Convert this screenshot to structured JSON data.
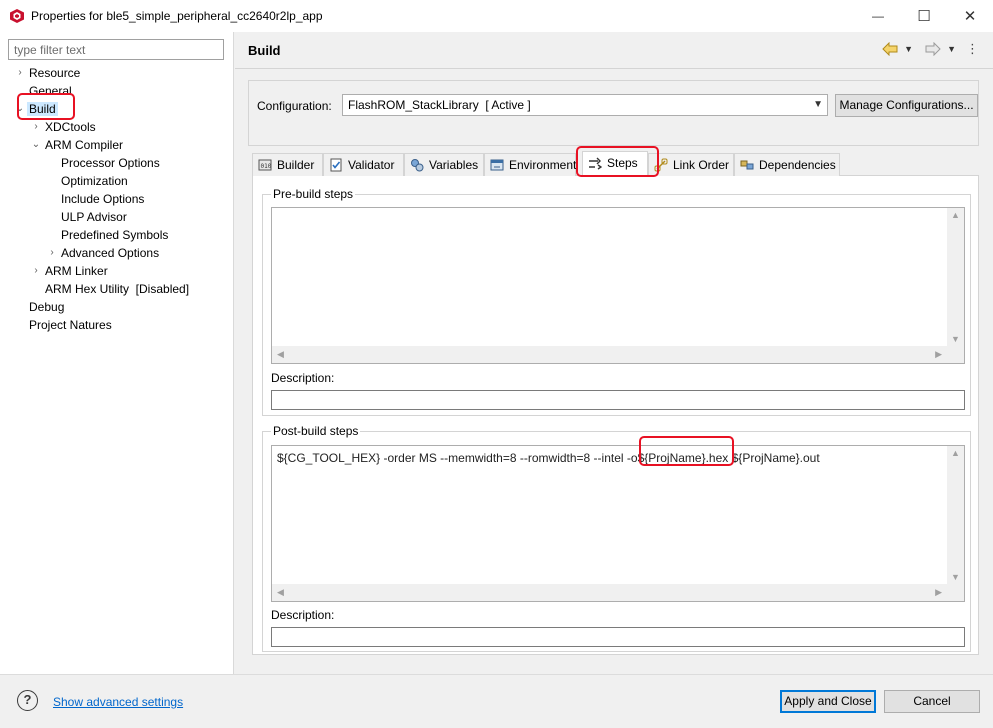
{
  "window": {
    "title": "Properties for ble5_simple_peripheral_cc2640r2lp_app",
    "minimize_glyph": "—",
    "maximize_glyph": "☐",
    "close_glyph": "✕"
  },
  "filter": {
    "placeholder": "type filter text",
    "value": ""
  },
  "tree": {
    "items": [
      {
        "label": "Resource",
        "expander": "›"
      },
      {
        "label": "General"
      },
      {
        "label": "Build",
        "expander": "⌄",
        "selected": true
      },
      {
        "label": "XDCtools",
        "expander": "›"
      },
      {
        "label": "ARM Compiler",
        "expander": "⌄"
      },
      {
        "label": "Processor Options"
      },
      {
        "label": "Optimization"
      },
      {
        "label": "Include Options"
      },
      {
        "label": "ULP Advisor"
      },
      {
        "label": "Predefined Symbols"
      },
      {
        "label": "Advanced Options",
        "expander": "›"
      },
      {
        "label": "ARM Linker",
        "expander": "›"
      },
      {
        "label": "ARM Hex Utility  [Disabled]"
      },
      {
        "label": "Debug"
      },
      {
        "label": "Project Natures"
      }
    ]
  },
  "header": {
    "title": "Build"
  },
  "configuration": {
    "label": "Configuration:",
    "value": "FlashROM_StackLibrary  [ Active ]",
    "manage_button": "Manage Configurations..."
  },
  "tabs": [
    {
      "label": "Builder",
      "icon": "builder-icon"
    },
    {
      "label": "Validator",
      "icon": "validator-icon"
    },
    {
      "label": "Variables",
      "icon": "variables-icon"
    },
    {
      "label": "Environment",
      "icon": "environment-icon"
    },
    {
      "label": "Steps",
      "icon": "steps-icon",
      "active": true
    },
    {
      "label": "Link Order",
      "icon": "link-order-icon"
    },
    {
      "label": "Dependencies",
      "icon": "dependencies-icon"
    }
  ],
  "pre_build": {
    "title": "Pre-build steps",
    "value": "",
    "description_label": "Description:",
    "description_value": ""
  },
  "post_build": {
    "title": "Post-build steps",
    "command_part1": "${CG_TOOL_HEX} -order MS --memwidth=8 --romwidth=8 --intel -o",
    "command_part2": "${ProjName}.hex",
    "command_part3": " ${ProjName}.out",
    "description_label": "Description:",
    "description_value": ""
  },
  "footer": {
    "help_glyph": "?",
    "advanced_link": "Show advanced settings",
    "apply_close": "Apply and Close",
    "cancel": "Cancel"
  },
  "colors": {
    "highlight": "#e81123",
    "selection": "#cce8ff",
    "link": "#0066cc",
    "primary_border": "#0078d7"
  }
}
